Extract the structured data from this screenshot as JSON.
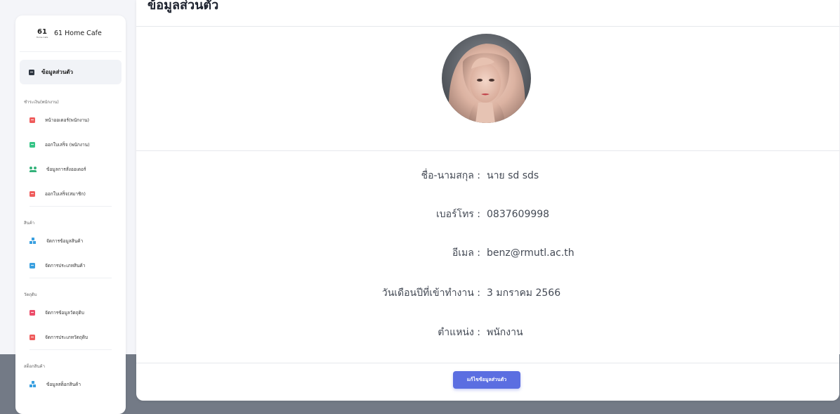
{
  "sidebar": {
    "brand": {
      "logo_text": "61",
      "logo_subtext": "Home Cafe",
      "name": "61 Home Cafe"
    },
    "active_item": {
      "label": "ข้อมูลส่วนตัว",
      "icon": "id-card-icon"
    },
    "sections": [
      {
        "title": "ชำระเงิน(พนักงาน)",
        "items": [
          {
            "label": "หน้าออเดอร์(พนักงาน)",
            "icon": "doc-red-icon"
          },
          {
            "label": "ออกใบเสร็จ (พนักงาน)",
            "icon": "doc-green-icon"
          },
          {
            "label": "ข้อมูลการสั่งออเดอร์",
            "icon": "users-icon"
          },
          {
            "label": "ออกใบเสร็จ(สมาชิก)",
            "icon": "doc-red-icon"
          }
        ]
      },
      {
        "title": "สินค้า",
        "items": [
          {
            "label": "จัดการข้อมูลสินค้า",
            "icon": "boxes-icon"
          },
          {
            "label": "จัดการประเภทสินค้า",
            "icon": "doc-blue-icon"
          }
        ]
      },
      {
        "title": "วัตถุดิบ",
        "items": [
          {
            "label": "จัดการข้อมูลวัตถุดิบ",
            "icon": "doc-pink-icon"
          },
          {
            "label": "จัดการประเภทวัตถุดิบ",
            "icon": "doc-red-icon"
          }
        ]
      },
      {
        "title": "สต็อกสินค้า",
        "items": [
          {
            "label": "ข้อมูลสต็อกสินค้า",
            "icon": "boxes-icon"
          }
        ]
      }
    ]
  },
  "main": {
    "title": "ข้อมูลส่วนตัว",
    "profile": {
      "name_label": "ชื่อ-นามสกุล :",
      "name_value": "นาย sd sds",
      "phone_label": "เบอร์โทร :",
      "phone_value": "0837609998",
      "email_label": "อีเมล :",
      "email_value": "benz@rmutl.ac.th",
      "start_label": "วันเดือนปีที่เข้าทำงาน :",
      "start_value": "3 มกราคม 2566",
      "position_label": "ตำแหน่ง :",
      "position_value": "พนักงาน"
    },
    "edit_button": "แก้ไขข้อมูลส่วนตัว"
  },
  "colors": {
    "accent": "#5b6ee1",
    "icon_red": "#ef5c5c",
    "icon_green": "#36c486",
    "icon_blue": "#3aa0e0",
    "backdrop": "#737a86"
  }
}
